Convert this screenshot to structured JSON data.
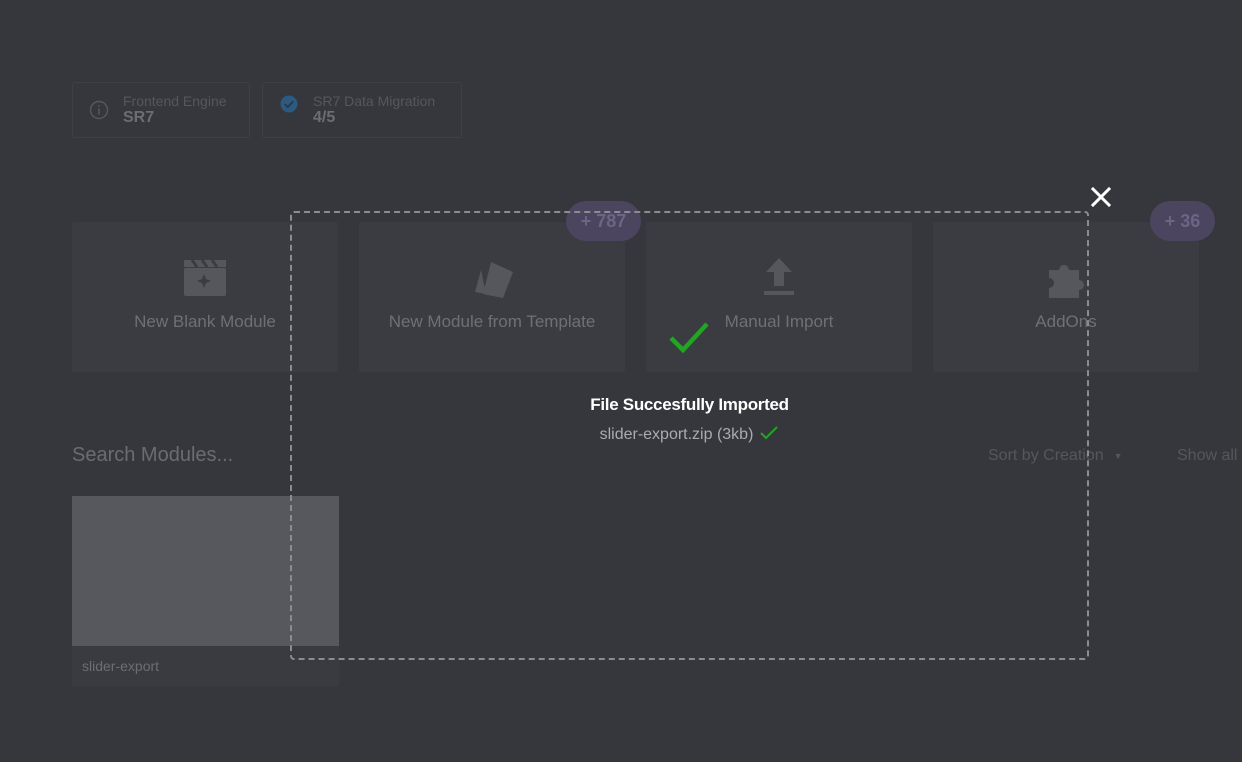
{
  "info": {
    "engine_label": "Frontend Engine",
    "engine_value": "SR7",
    "migration_label": "SR7 Data Migration",
    "migration_value": "4/5"
  },
  "cards": {
    "blank_label": "New Blank Module",
    "template_label": "New Module from Template",
    "import_label": "Manual Import",
    "addons_label": "AddOns",
    "template_badge": "+ 787",
    "addons_badge": "+ 36"
  },
  "list": {
    "search_placeholder": "Search Modules...",
    "sort_label": "Sort by Creation",
    "sort_caret": "▼",
    "show_all": "Show all",
    "module_name": "slider-export"
  },
  "import_dialog": {
    "title": "File Succesfully Imported",
    "file_info": "slider-export.zip (3kb)"
  },
  "colors": {
    "success": "#22a622",
    "badge": "#4b4560",
    "background": "#35373c"
  },
  "icons": {
    "info": "info-icon",
    "migration": "check-circle-icon",
    "blank": "clapperboard-sparkle-icon",
    "template": "cards-icon",
    "import": "upload-icon",
    "addons": "puzzle-icon",
    "close": "close-icon",
    "success": "checkmark-icon"
  }
}
